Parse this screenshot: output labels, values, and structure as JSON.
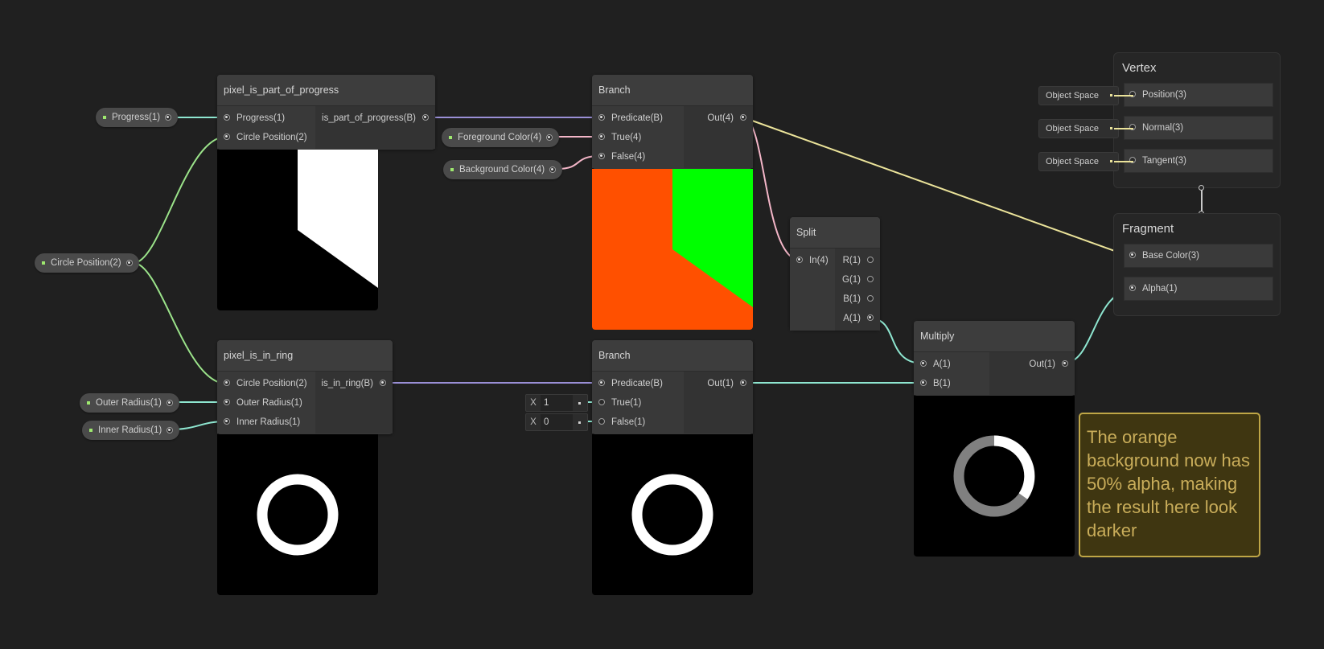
{
  "nodes": {
    "progress_node": {
      "title": "pixel_is_part_of_progress",
      "inputs": [
        "Progress(1)",
        "Circle Position(2)"
      ],
      "output": "is_part_of_progress(B)"
    },
    "ring_node": {
      "title": "pixel_is_in_ring",
      "inputs": [
        "Circle Position(2)",
        "Outer Radius(1)",
        "Inner Radius(1)"
      ],
      "output": "is_in_ring(B)"
    },
    "branch_top": {
      "title": "Branch",
      "inputs": [
        "Predicate(B)",
        "True(4)",
        "False(4)"
      ],
      "output": "Out(4)"
    },
    "branch_bottom": {
      "title": "Branch",
      "inputs": [
        "Predicate(B)",
        "True(1)",
        "False(1)"
      ],
      "output": "Out(1)",
      "true_value": "1",
      "false_value": "0",
      "vec_label": "X"
    },
    "split": {
      "title": "Split",
      "input": "In(4)",
      "outputs": [
        "R(1)",
        "G(1)",
        "B(1)",
        "A(1)"
      ]
    },
    "multiply": {
      "title": "Multiply",
      "inputs": [
        "A(1)",
        "B(1)"
      ],
      "output": "Out(1)"
    }
  },
  "properties": {
    "progress": "Progress(1)",
    "circle_position": "Circle Position(2)",
    "outer_radius": "Outer Radius(1)",
    "inner_radius": "Inner Radius(1)",
    "foreground_color": "Foreground Color(4)",
    "background_color": "Background Color(4)"
  },
  "master": {
    "vertex": {
      "title": "Vertex",
      "slots": [
        "Position(3)",
        "Normal(3)",
        "Tangent(3)"
      ],
      "space_tags": [
        "Object Space",
        "Object Space",
        "Object Space"
      ]
    },
    "fragment": {
      "title": "Fragment",
      "slots": [
        "Base Color(3)",
        "Alpha(1)"
      ]
    }
  },
  "sticky_note": "The orange background now has 50% alpha, making the result here look darker",
  "colors": {
    "background": "#202020",
    "orange": "#ff5000",
    "green": "#00ff00",
    "wire_float": "#8ee6d0",
    "wire_vec2": "#9be38a",
    "wire_bool": "#9a8fd6",
    "wire_vec4": "#f4b6c8",
    "wire_vec3": "#ebe39a",
    "sticky_border": "#bfa646"
  }
}
